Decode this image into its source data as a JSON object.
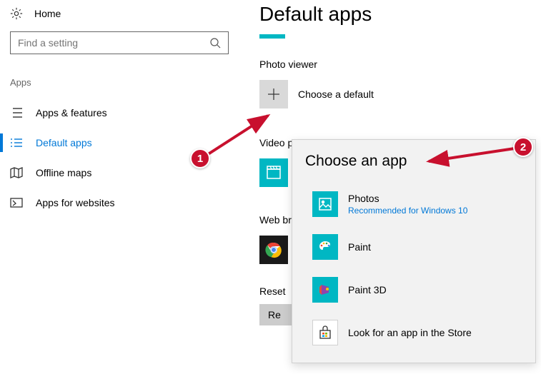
{
  "sidebar": {
    "home_label": "Home",
    "search_placeholder": "Find a setting",
    "section_label": "Apps",
    "items": [
      {
        "label": "Apps & features"
      },
      {
        "label": "Default apps"
      },
      {
        "label": "Offline maps"
      },
      {
        "label": "Apps for websites"
      }
    ]
  },
  "main": {
    "title": "Default apps",
    "photo_viewer_label": "Photo viewer",
    "choose_default_label": "Choose a default",
    "video_player_label": "Video player",
    "web_browser_label": "Web browser",
    "reset_label": "Reset to the Microsoft recommended defaults",
    "reset_label_short": "Reset",
    "reset_button_label": "Reset",
    "reset_button_partial": "Re"
  },
  "popup": {
    "title": "Choose an app",
    "apps": [
      {
        "name": "Photos",
        "sub": "Recommended for Windows 10"
      },
      {
        "name": "Paint"
      },
      {
        "name": "Paint 3D"
      },
      {
        "name": "Look for an app in the Store"
      }
    ]
  },
  "annotations": {
    "badge1": "1",
    "badge2": "2"
  }
}
